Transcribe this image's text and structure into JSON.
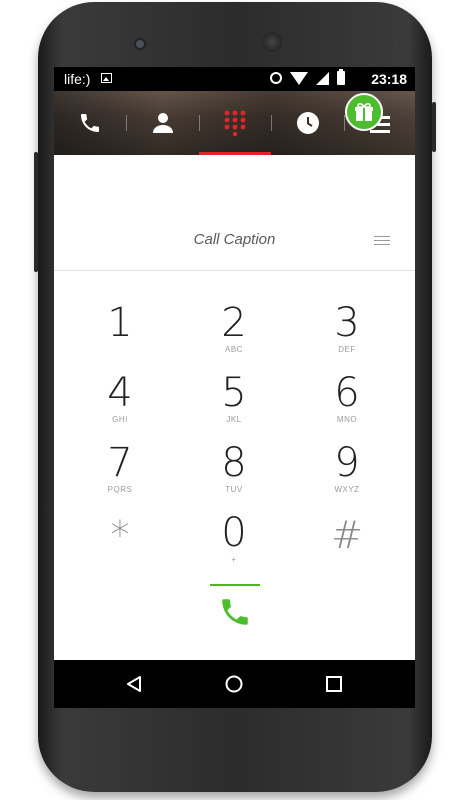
{
  "status_bar": {
    "carrier": "life:)",
    "time": "23:18",
    "icons": [
      "image-icon",
      "alarm-icon",
      "wifi-icon",
      "signal-icon",
      "battery-icon"
    ]
  },
  "tabs": [
    {
      "name": "calls",
      "icon": "phone-icon"
    },
    {
      "name": "contacts",
      "icon": "person-icon"
    },
    {
      "name": "dialpad",
      "icon": "dialpad-icon",
      "active": true
    },
    {
      "name": "history",
      "icon": "clock-icon"
    }
  ],
  "actions": {
    "gift_icon": "gift-icon",
    "menu_icon": "menu-icon"
  },
  "caption": {
    "text": "Call Caption"
  },
  "dialpad": {
    "keys": [
      {
        "digit": "1",
        "letters": ""
      },
      {
        "digit": "2",
        "letters": "ABC"
      },
      {
        "digit": "3",
        "letters": "DEF"
      },
      {
        "digit": "4",
        "letters": "GHI"
      },
      {
        "digit": "5",
        "letters": "JKL"
      },
      {
        "digit": "6",
        "letters": "MNO"
      },
      {
        "digit": "7",
        "letters": "PQRS"
      },
      {
        "digit": "8",
        "letters": "TUV"
      },
      {
        "digit": "9",
        "letters": "WXYZ"
      },
      {
        "digit": "*",
        "letters": ""
      },
      {
        "digit": "0",
        "letters": "+"
      },
      {
        "digit": "#",
        "letters": ""
      }
    ]
  },
  "colors": {
    "accent_red": "#e0262b",
    "call_green": "#4cbe2e",
    "digit_color": "#222222"
  }
}
